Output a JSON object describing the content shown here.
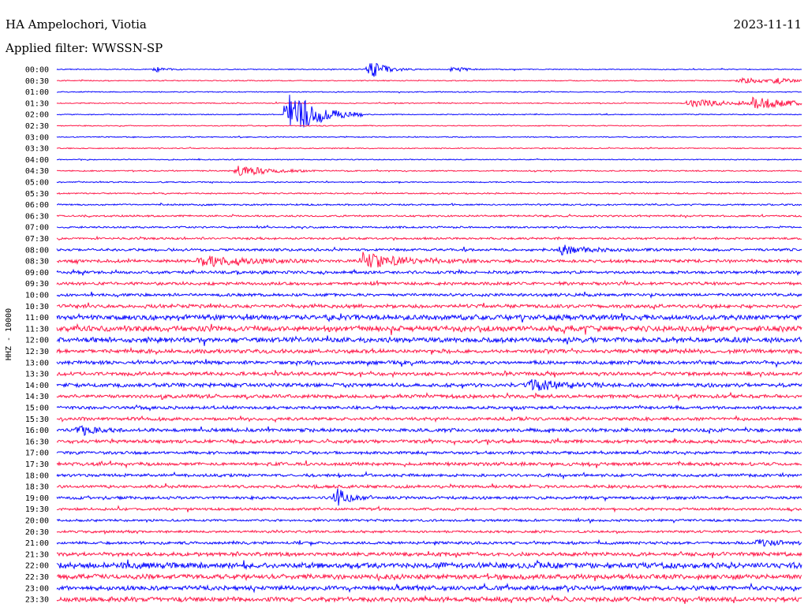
{
  "header": {
    "station": "HA Ampelochori, Viotia",
    "date": "2023-11-11",
    "filter": "Applied filter: WWSSN-SP"
  },
  "channel_label": "HHZ - 10000",
  "colors": {
    "trace_a": "#0a0aff",
    "trace_b": "#ff1a4a",
    "text": "#000000",
    "background": "#ffffff"
  },
  "chart_data": {
    "type": "line",
    "title": "HA Ampelochori, Viotia",
    "xlabel": "",
    "ylabel": "HHZ - 10000",
    "grid": false,
    "legend": "none",
    "row_duration_minutes": 30,
    "row_labels": [
      "00:00",
      "00:30",
      "01:00",
      "01:30",
      "02:00",
      "02:30",
      "03:00",
      "03:30",
      "04:00",
      "04:30",
      "05:00",
      "05:30",
      "06:00",
      "06:30",
      "07:00",
      "07:30",
      "08:00",
      "08:30",
      "09:00",
      "09:30",
      "10:00",
      "10:30",
      "11:00",
      "11:30",
      "12:00",
      "12:30",
      "13:00",
      "13:30",
      "14:00",
      "14:30",
      "15:00",
      "15:30",
      "16:00",
      "16:30",
      "17:00",
      "17:30",
      "18:00",
      "18:30",
      "19:00",
      "19:30",
      "20:00",
      "20:30",
      "21:00",
      "21:30",
      "22:00",
      "22:30",
      "23:00",
      "23:30"
    ],
    "row_noise_level": [
      0.5,
      0.5,
      0.5,
      0.5,
      0.5,
      0.5,
      0.5,
      0.5,
      0.5,
      0.6,
      0.6,
      0.7,
      0.8,
      0.9,
      0.9,
      1.0,
      1.3,
      1.6,
      1.5,
      1.5,
      1.5,
      1.8,
      2.6,
      2.8,
      2.6,
      2.0,
      1.8,
      1.8,
      2.0,
      1.8,
      1.6,
      1.6,
      1.8,
      1.8,
      1.5,
      1.7,
      1.5,
      1.5,
      1.5,
      1.3,
      1.2,
      1.2,
      1.4,
      2.0,
      3.0,
      2.5,
      2.3,
      2.4
    ],
    "events": [
      {
        "row": 0,
        "minute": 4.0,
        "amplitude": 3,
        "duration_minutes": 0.4
      },
      {
        "row": 0,
        "minute": 12.6,
        "amplitude": 12,
        "duration_minutes": 0.6
      },
      {
        "row": 0,
        "minute": 16.0,
        "amplitude": 4,
        "duration_minutes": 0.4
      },
      {
        "row": 1,
        "minute": 27.5,
        "amplitude": 4,
        "duration_minutes": 1.0
      },
      {
        "row": 1,
        "minute": 29.0,
        "amplitude": 4,
        "duration_minutes": 0.4
      },
      {
        "row": 3,
        "minute": 25.5,
        "amplitude": 5,
        "duration_minutes": 2.0
      },
      {
        "row": 3,
        "minute": 28.0,
        "amplitude": 6,
        "duration_minutes": 2.0
      },
      {
        "row": 4,
        "minute": 9.3,
        "amplitude": 35,
        "duration_minutes": 1.0
      },
      {
        "row": 9,
        "minute": 7.3,
        "amplitude": 7,
        "duration_minutes": 1.2
      },
      {
        "row": 16,
        "minute": 20.3,
        "amplitude": 6,
        "duration_minutes": 1.0
      },
      {
        "row": 17,
        "minute": 5.8,
        "amplitude": 7,
        "duration_minutes": 1.6
      },
      {
        "row": 17,
        "minute": 12.3,
        "amplitude": 10,
        "duration_minutes": 1.6
      },
      {
        "row": 28,
        "minute": 19.1,
        "amplitude": 8,
        "duration_minutes": 1.0
      },
      {
        "row": 32,
        "minute": 0.9,
        "amplitude": 6,
        "duration_minutes": 0.6
      },
      {
        "row": 38,
        "minute": 11.3,
        "amplitude": 12,
        "duration_minutes": 0.4
      },
      {
        "row": 42,
        "minute": 28.3,
        "amplitude": 5,
        "duration_minutes": 0.6
      }
    ]
  }
}
